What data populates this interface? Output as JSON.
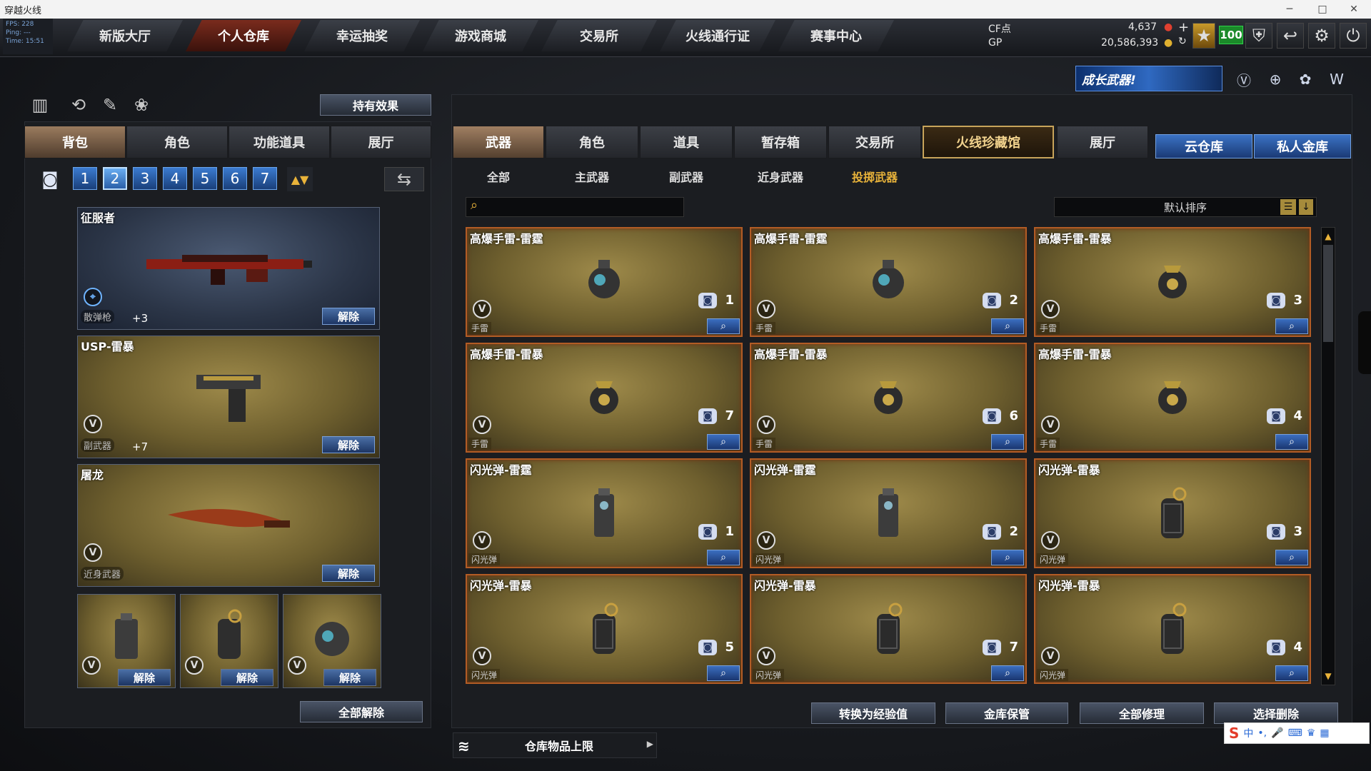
{
  "window": {
    "title": "穿越火线"
  },
  "fps": {
    "fps": "FPS: 228",
    "ping": "Ping: ---",
    "time": "Time: 15:51"
  },
  "nav": [
    "新版大厅",
    "个人仓库",
    "幸运抽奖",
    "游戏商城",
    "交易所",
    "火线通行证",
    "赛事中心"
  ],
  "nav_active": 1,
  "currency": {
    "cf_label": "CF点",
    "cf_value": "4,637",
    "gp_label": "GP",
    "gp_value": "20,586,393",
    "level": "100"
  },
  "promo": {
    "text": "成长武器!"
  },
  "left": {
    "effect_btn": "持有效果",
    "tabs": [
      "背包",
      "角色",
      "功能道具",
      "展厅"
    ],
    "pages": [
      "1",
      "2",
      "3",
      "4",
      "5",
      "6",
      "7"
    ],
    "page_active": "2",
    "items": [
      {
        "name": "征服者",
        "type": "散弹枪",
        "plus": "+3",
        "remove": "解除"
      },
      {
        "name": "USP-雷暴",
        "type": "副武器",
        "plus": "+7",
        "remove": "解除"
      },
      {
        "name": "屠龙",
        "type": "近身武器",
        "remove": "解除"
      }
    ],
    "small_remove": [
      "解除",
      "解除",
      "解除"
    ],
    "remove_all": "全部解除"
  },
  "right": {
    "tabs": [
      "武器",
      "角色",
      "道具",
      "暂存箱",
      "交易所",
      "火线珍藏馆",
      "展厅"
    ],
    "cloud": "云仓库",
    "private_vault": "私人金库",
    "subtabs": [
      "全部",
      "主武器",
      "副武器",
      "近身武器",
      "投掷武器"
    ],
    "subtab_active": 4,
    "sort": "默认排序",
    "cards": [
      {
        "name": "高爆手雷-雷霆",
        "type": "手雷",
        "count": "1",
        "kind": "grenade"
      },
      {
        "name": "高爆手雷-雷霆",
        "type": "手雷",
        "count": "2",
        "kind": "grenade"
      },
      {
        "name": "高爆手雷-雷暴",
        "type": "手雷",
        "count": "3",
        "kind": "grenade2"
      },
      {
        "name": "高爆手雷-雷暴",
        "type": "手雷",
        "count": "7",
        "kind": "grenade2"
      },
      {
        "name": "高爆手雷-雷暴",
        "type": "手雷",
        "count": "6",
        "kind": "grenade2"
      },
      {
        "name": "高爆手雷-雷暴",
        "type": "手雷",
        "count": "4",
        "kind": "grenade2"
      },
      {
        "name": "闪光弹-雷霆",
        "type": "闪光弹",
        "count": "1",
        "kind": "flash"
      },
      {
        "name": "闪光弹-雷霆",
        "type": "闪光弹",
        "count": "2",
        "kind": "flash"
      },
      {
        "name": "闪光弹-雷暴",
        "type": "闪光弹",
        "count": "3",
        "kind": "flash2"
      },
      {
        "name": "闪光弹-雷暴",
        "type": "闪光弹",
        "count": "5",
        "kind": "flash2"
      },
      {
        "name": "闪光弹-雷暴",
        "type": "闪光弹",
        "count": "7",
        "kind": "flash2"
      },
      {
        "name": "闪光弹-雷暴",
        "type": "闪光弹",
        "count": "4",
        "kind": "flash2"
      }
    ],
    "bottom": [
      "转换为经验值",
      "金库保管",
      "全部修理",
      "选择删除"
    ],
    "storage": "仓库物品上限"
  },
  "ime": {
    "mode": "中"
  }
}
